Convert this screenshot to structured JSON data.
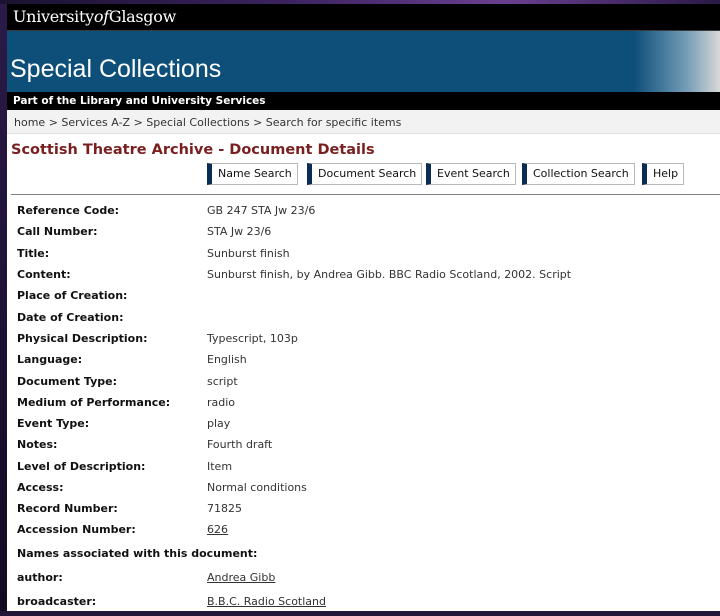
{
  "header": {
    "university_name_part1": "University",
    "university_name_of": "of",
    "university_name_part2": "Glasgow",
    "banner_title": "Special Collections",
    "sub_title": "Part of the Library and University Services"
  },
  "breadcrumb": [
    "home",
    "Services A-Z",
    "Special Collections",
    "Search for specific items"
  ],
  "page_title": "Scottish Theatre Archive - Document Details",
  "buttons": {
    "name_search": "Name Search",
    "document_search": "Document Search",
    "event_search": "Event Search",
    "collection_search": "Collection Search",
    "help": "Help"
  },
  "details": [
    {
      "label": "Reference Code:",
      "value": "GB 247 STA Jw 23/6"
    },
    {
      "label": "Call Number:",
      "value": "STA Jw 23/6"
    },
    {
      "label": "Title:",
      "value": "Sunburst finish"
    },
    {
      "label": "Content:",
      "value": "Sunburst finish, by Andrea Gibb. BBC Radio Scotland, 2002. Script"
    },
    {
      "label": "Place of Creation:",
      "value": ""
    },
    {
      "label": "Date of Creation:",
      "value": ""
    },
    {
      "label": "Physical Description:",
      "value": "Typescript, 103p"
    },
    {
      "label": "Language:",
      "value": "English"
    },
    {
      "label": "Document Type:",
      "value": "script"
    },
    {
      "label": "Medium of Performance:",
      "value": "radio"
    },
    {
      "label": "Event Type:",
      "value": "play"
    },
    {
      "label": "Notes:",
      "value": "Fourth draft"
    },
    {
      "label": "Level of Description:",
      "value": "Item"
    },
    {
      "label": "Access:",
      "value": "Normal conditions"
    },
    {
      "label": "Record Number:",
      "value": "71825"
    },
    {
      "label": "Accession Number:",
      "value": "626"
    }
  ],
  "names_heading": "Names associated with this document:",
  "names": [
    {
      "role": "author",
      "label": "author:",
      "value": "Andrea Gibb"
    },
    {
      "role": "broadcaster",
      "label": "broadcaster:",
      "value": "B.B.C. Radio Scotland"
    }
  ]
}
